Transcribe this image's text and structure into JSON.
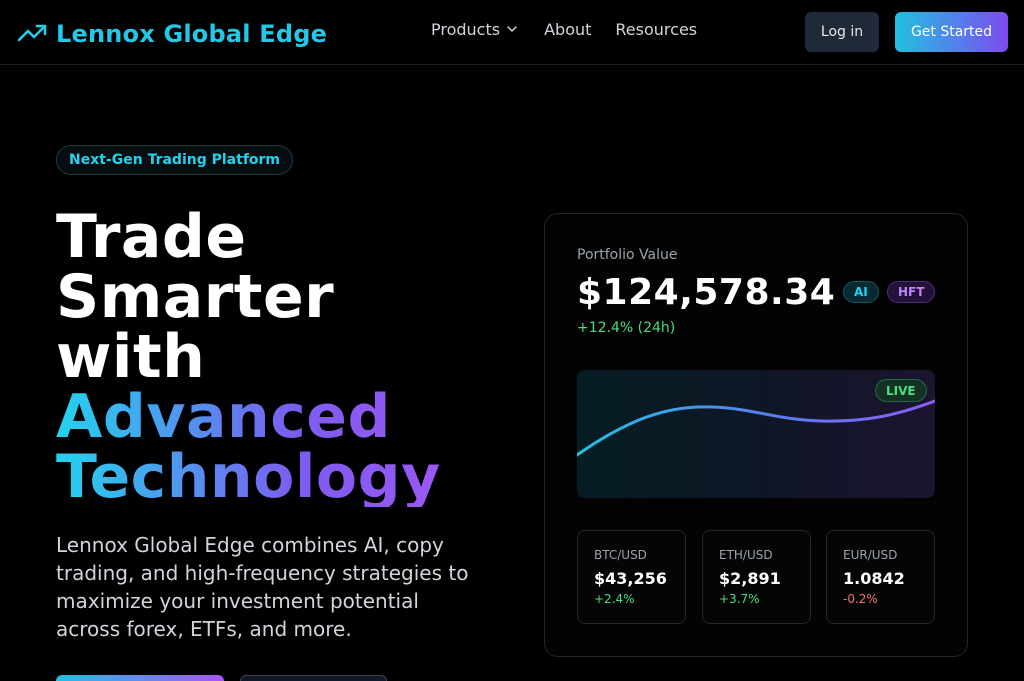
{
  "nav": {
    "brand": "Lennox Global Edge",
    "brand_icon": "trending-up-icon",
    "links": [
      {
        "label": "Products",
        "has_dropdown": true
      },
      {
        "label": "About"
      },
      {
        "label": "Resources"
      }
    ],
    "login_label": "Log in",
    "get_started_label": "Get Started"
  },
  "hero": {
    "badge": "Next-Gen Trading Platform",
    "headline_plain": [
      "Trade",
      "Smarter",
      "with"
    ],
    "headline_gradient": [
      "Advanced",
      "Technology"
    ],
    "subtitle": "Lennox Global Edge combines AI, copy trading, and high-frequency strategies to maximize your investment potential across forex, ETFs, and more."
  },
  "portfolio": {
    "label": "Portfolio Value",
    "value": "$124,578.34",
    "tags": [
      "AI",
      "HFT"
    ],
    "change": "+12.4% (24h)",
    "live_label": "LIVE",
    "tickers": [
      {
        "symbol": "BTC/USD",
        "price": "$43,256",
        "change": "+2.4%",
        "direction": "up"
      },
      {
        "symbol": "ETH/USD",
        "price": "$2,891",
        "change": "+3.7%",
        "direction": "up"
      },
      {
        "symbol": "EUR/USD",
        "price": "1.0842",
        "change": "-0.2%",
        "direction": "down"
      }
    ]
  },
  "colors": {
    "accent_cyan": "#22d3ee",
    "accent_purple": "#a855f7",
    "positive": "#4ade80",
    "negative": "#f87171"
  }
}
